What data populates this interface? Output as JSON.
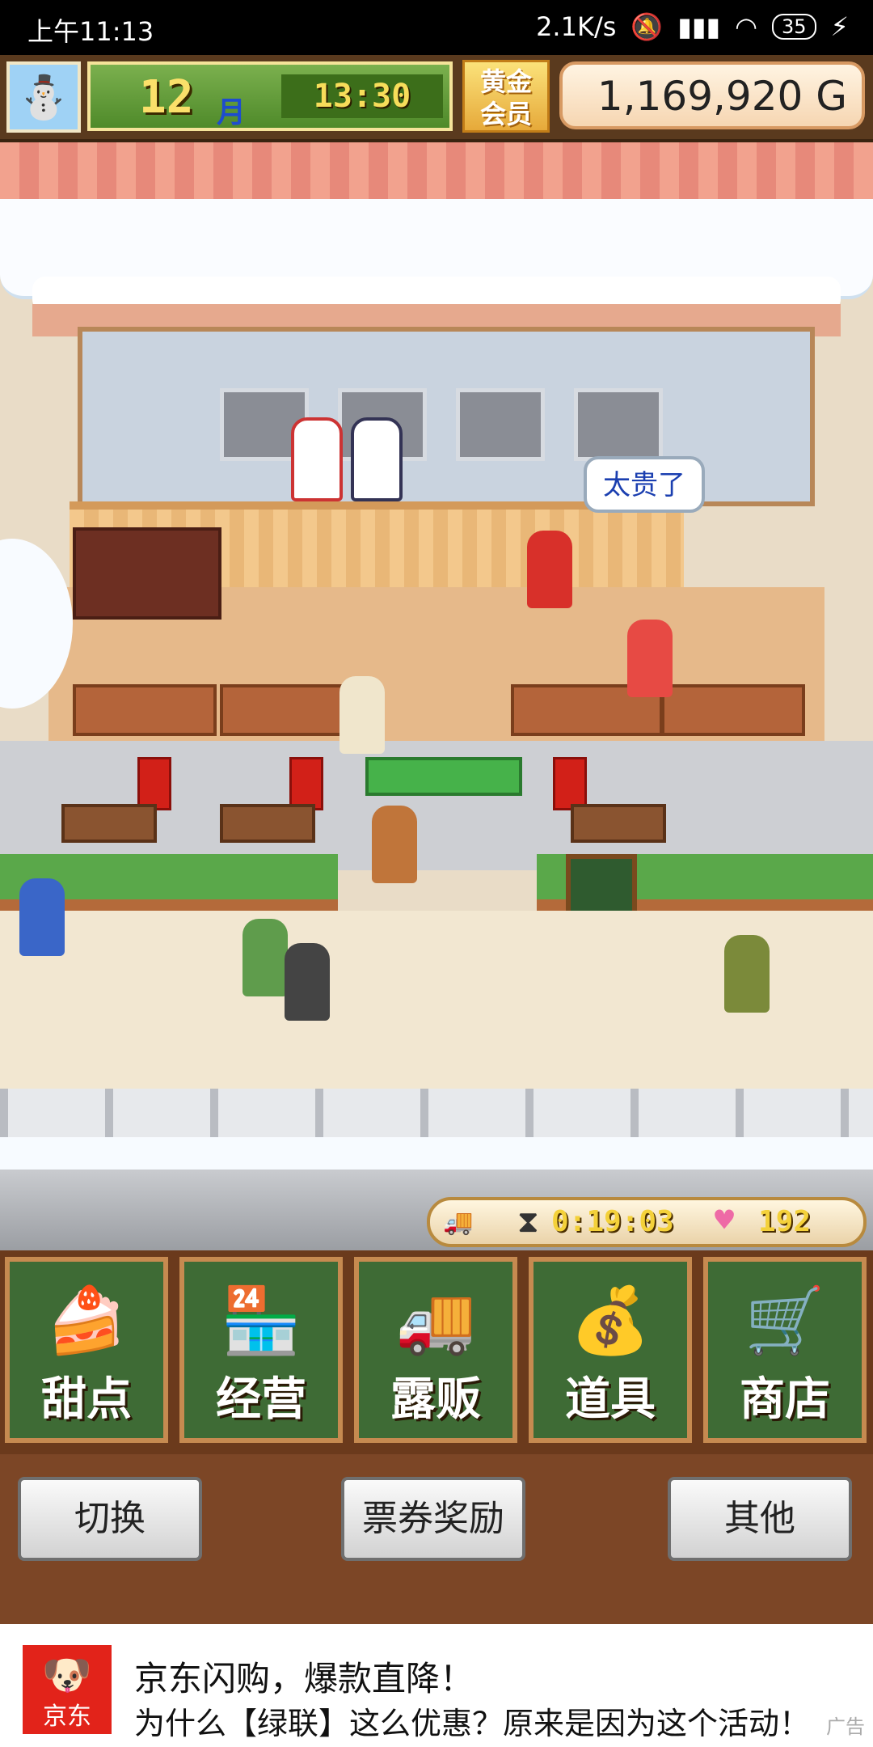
{
  "status_bar": {
    "time": "上午11:13",
    "network_speed": "2.1K/s",
    "battery": "35"
  },
  "hud": {
    "avatar_icon": "snowman-icon",
    "month_number": "12",
    "month_label": "月",
    "clock": "13:30",
    "gold_member_label": "黄金会员",
    "money": "1,169,920 G"
  },
  "scene": {
    "speech_bubble": "太贵了"
  },
  "timer_bar": {
    "truck_icon": "food-truck-icon",
    "timer": "0:19:03",
    "heart_icon": "heart-icon",
    "hearts": "192"
  },
  "main_menu": [
    {
      "label": "甜点",
      "icon": "cake-icon"
    },
    {
      "label": "经营",
      "icon": "shop-icon"
    },
    {
      "label": "露贩",
      "icon": "food-truck-icon"
    },
    {
      "label": "道具",
      "icon": "item-bag-icon"
    },
    {
      "label": "商店",
      "icon": "shopping-cart-icon"
    }
  ],
  "bottom_buttons": {
    "switch": "切换",
    "tickets": "票券奖励",
    "other": "其他"
  },
  "ad": {
    "brand": "京东",
    "title": "京东闪购，爆款直降！",
    "description": "为什么【绿联】这么优惠？原来是因为这个活动！",
    "tag": "广告"
  }
}
